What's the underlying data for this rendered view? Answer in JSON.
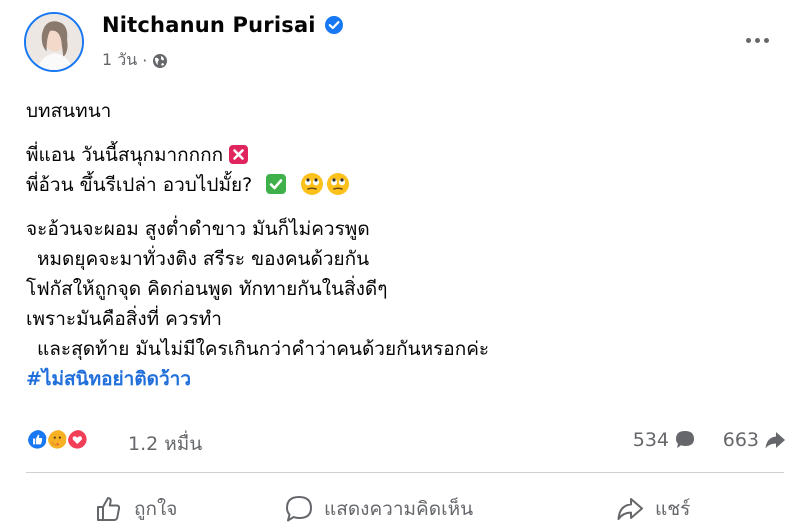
{
  "post": {
    "author": "Nitchanun Purisai",
    "verified": true,
    "timestamp": "1 วัน",
    "audience_icon": "globe-icon",
    "more_icon": "more-options-icon"
  },
  "body": {
    "lines": [
      "บทสนทนา",
      "พี่แอน วันนี้สนุกมากกกก",
      "พี่อ้วน ขึ้นรีเปล่า อวบไปมั้ย?",
      "จะอ้วนจะผอม สูงต่ำดำขาว มันก็ไม่ควรพูด",
      "หมดยุคจะมาทั่วงติง สรีระ ของคนด้วยกัน",
      "โฟกัสให้ถูกจุด คิดก่อนพูด ทักทายกันในสิ่งดีๆ",
      "เพราะมันคือสิ่งที่ ควรทำ",
      "และสุดท้าย มันไม่มีใครเกินกว่าคำว่าคนด้วยกันหรอกค่ะ"
    ],
    "hashtag": "#ไม่สนิทอย่าติดว้าว",
    "emojis": {
      "line2": "cross-mark-emoji",
      "line3": [
        "check-mark-emoji",
        "rolling-eyes-emoji",
        "rolling-eyes-emoji"
      ]
    }
  },
  "stats": {
    "reaction_icons": [
      "like-reaction-icon",
      "care-reaction-icon",
      "love-reaction-icon"
    ],
    "reactions": "1.2 หมื่น",
    "comments": "534",
    "shares": "663"
  },
  "actions": {
    "like": "ถูกใจ",
    "comment": "แสดงความคิดเห็น",
    "share": "แชร์"
  },
  "colors": {
    "accent": "#1877f2",
    "hashtag": "#216fdb",
    "secondary_text": "#65676b",
    "divider": "#ced0d4"
  }
}
